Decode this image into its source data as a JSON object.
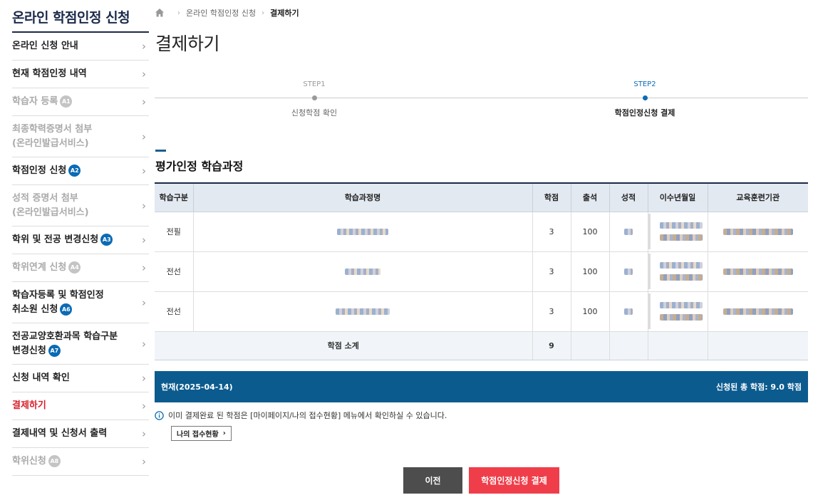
{
  "sidebar": {
    "title": "온라인 학점인정 신청",
    "items": [
      {
        "label": "온라인 신청 안내",
        "badge": "",
        "state": "normal"
      },
      {
        "label": "현재 학점인정 내역",
        "badge": "",
        "state": "normal"
      },
      {
        "label": "학습자 등록",
        "badge": "A1",
        "state": "disabled"
      },
      {
        "label": "최종학력증명서 첨부\n(온라인발급서비스)",
        "badge": "",
        "state": "disabled"
      },
      {
        "label": "학점인정 신청",
        "badge": "A2",
        "state": "normal"
      },
      {
        "label": "성적 증명서 첨부\n(온라인발급서비스)",
        "badge": "",
        "state": "disabled"
      },
      {
        "label": "학위 및 전공 변경신청",
        "badge": "A3",
        "state": "normal"
      },
      {
        "label": "학위연계 신청",
        "badge": "A4",
        "state": "disabled"
      },
      {
        "label": "학습자등록 및 학점인정\n취소원 신청",
        "badge": "A6",
        "state": "normal"
      },
      {
        "label": "전공교양호환과목 학습구분\n변경신청",
        "badge": "A7",
        "state": "normal"
      },
      {
        "label": "신청 내역 확인",
        "badge": "",
        "state": "normal"
      },
      {
        "label": "결제하기",
        "badge": "",
        "state": "active"
      },
      {
        "label": "결제내역 및 신청서 출력",
        "badge": "",
        "state": "normal"
      },
      {
        "label": "학위신청",
        "badge": "A8",
        "state": "disabled"
      }
    ]
  },
  "breadcrumb": {
    "level1": "온라인 학점인정 신청",
    "current": "결제하기"
  },
  "page_title": "결제하기",
  "steps": [
    {
      "num": "STEP1",
      "label": "신청학점 확인"
    },
    {
      "num": "STEP2",
      "label": "학점인정신청 결제"
    }
  ],
  "section_title": "평가인정 학습과정",
  "table": {
    "headers": [
      "학습구분",
      "학습과정명",
      "학점",
      "출석",
      "성적",
      "이수년월일",
      "교육훈련기관"
    ],
    "rows": [
      {
        "type": "전필",
        "credit": "3",
        "attendance": "100"
      },
      {
        "type": "전선",
        "credit": "3",
        "attendance": "100"
      },
      {
        "type": "전선",
        "credit": "3",
        "attendance": "100"
      }
    ],
    "subtotal_label": "학점 소계",
    "subtotal_value": "9"
  },
  "summary": {
    "date": "현재(2025-04-14)",
    "total": "신청된 총 학점: 9.0 학점"
  },
  "notice": "이미 결제완료 된 학점은 [마이페이지/나의 접수현황] 메뉴에서 확인하실 수 있습니다.",
  "receipt_button": "나의 접수현황",
  "buttons": {
    "prev": "이전",
    "pay": "학점인정신청 결제"
  },
  "colors": {
    "brand_navy": "#1b2a4a",
    "accent_blue": "#0b5b8f",
    "pay_red": "#ef3e4a",
    "active_red": "#d81e2c"
  }
}
